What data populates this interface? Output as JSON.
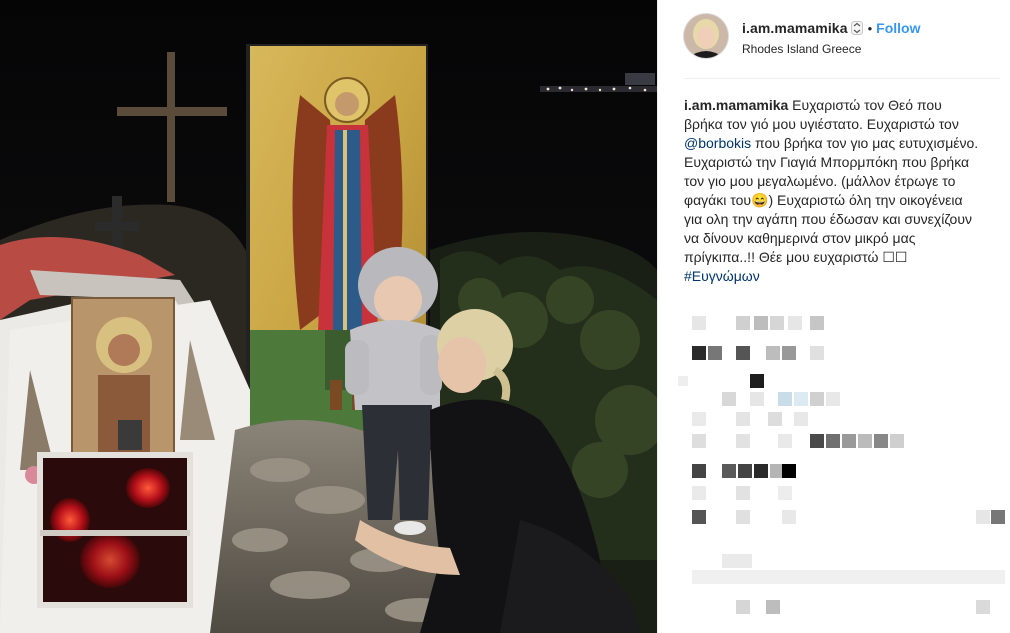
{
  "post": {
    "username": "i.am.mamamika",
    "follow_label": "Follow",
    "dot": "•",
    "location": "Rhodes Island Greece",
    "caption": {
      "user": "i.am.mamamika",
      "part1": " Ευχαριστώ τον Θεό που βρήκα τον γιό μου υγιέστατο. Ευχαριστώ τον ",
      "mention": "@borbokis",
      "part2": " που βρήκα τον γιο μας ευτυχισμένο. Ευχαριστώ την Γιαγιά Μπορμπόκη που βρήκα τον γιο μου μεγαλωμένο. (μάλλον έτρωγε το φαγάκι του😄) Ευχαριστώ όλη την οικογένεια για ολη την αγάπη που έδωσαν και συνεχίζουν να δίνουν καθημερινά στον μικρό μας πρίγκιπα..!! Θέε μου ευχαριστώ ☐☐ ",
      "hashtag": "#Ευγνώμων"
    }
  },
  "icons": {
    "verify": "verified-badge-icon",
    "avatar": "profile-avatar"
  },
  "colors": {
    "link": "#3897f0",
    "text": "#262626",
    "hashtag": "#003569"
  }
}
